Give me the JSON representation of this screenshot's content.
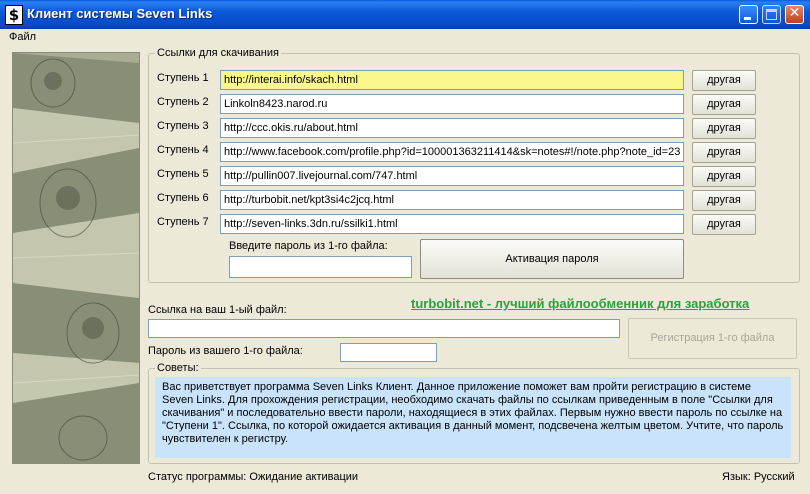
{
  "window": {
    "app_icon_glyph": "$",
    "title": "Клиент системы Seven Links"
  },
  "menu": {
    "file": "Файл"
  },
  "links": {
    "legend": "Ссылки для скачивания",
    "steps": [
      {
        "label": "Ступень 1",
        "url": "http://interai.info/skach.html",
        "button": "другая"
      },
      {
        "label": "Ступень 2",
        "url": "Linkoln8423.narod.ru",
        "button": "другая"
      },
      {
        "label": "Ступень 3",
        "url": "http://ccc.okis.ru/about.html",
        "button": "другая"
      },
      {
        "label": "Ступень 4",
        "url": "http://www.facebook.com/profile.php?id=100001363211414&sk=notes#!/note.php?note_id=23",
        "button": "другая"
      },
      {
        "label": "Ступень 5",
        "url": "http://pullin007.livejournal.com/747.html",
        "button": "другая"
      },
      {
        "label": "Ступень 6",
        "url": "http://turbobit.net/kpt3si4c2jcq.html",
        "button": "другая"
      },
      {
        "label": "Ступень 7",
        "url": "http://seven-links.3dn.ru/ssilki1.html",
        "button": "другая"
      }
    ],
    "password_prompt": "Введите пароль из 1-го файла:",
    "password_value": "",
    "activate_button": "Активация пароля"
  },
  "promo": "turbobit.net - лучший файлообменник для заработка",
  "registration": {
    "link_label": "Ссылка на ваш 1-ый файл:",
    "link_value": "",
    "password_label": "Пароль из вашего 1-го файла:",
    "password_value": "",
    "register_button": "Регистрация 1-го файла"
  },
  "tips": {
    "legend": "Советы:",
    "text": "Вас приветствует программа Seven Links Клиент. Данное приложение поможет вам пройти регистрацию в системе Seven Links. Для прохождения регистрации, необходимо скачать файлы по ссылкам приведенным в поле \"Ссылки для скачивания\" и последовательно ввести пароли, находящиеся в этих файлах. Первым нужно ввести пароль по ссылке на \"Ступени 1\". Ссылка, по которой ожидается активация в данный момент, подсвечена желтым цветом. Учтите, что пароль чувствителен к регистру."
  },
  "status": "Статус программы: Ожидание активации",
  "language": "Язык: Русский",
  "colors": {
    "highlight": "#f9f78c",
    "tips_bg": "#c8e3fa",
    "promo": "#2aa33a",
    "titlebar": "#0a5bdc"
  }
}
